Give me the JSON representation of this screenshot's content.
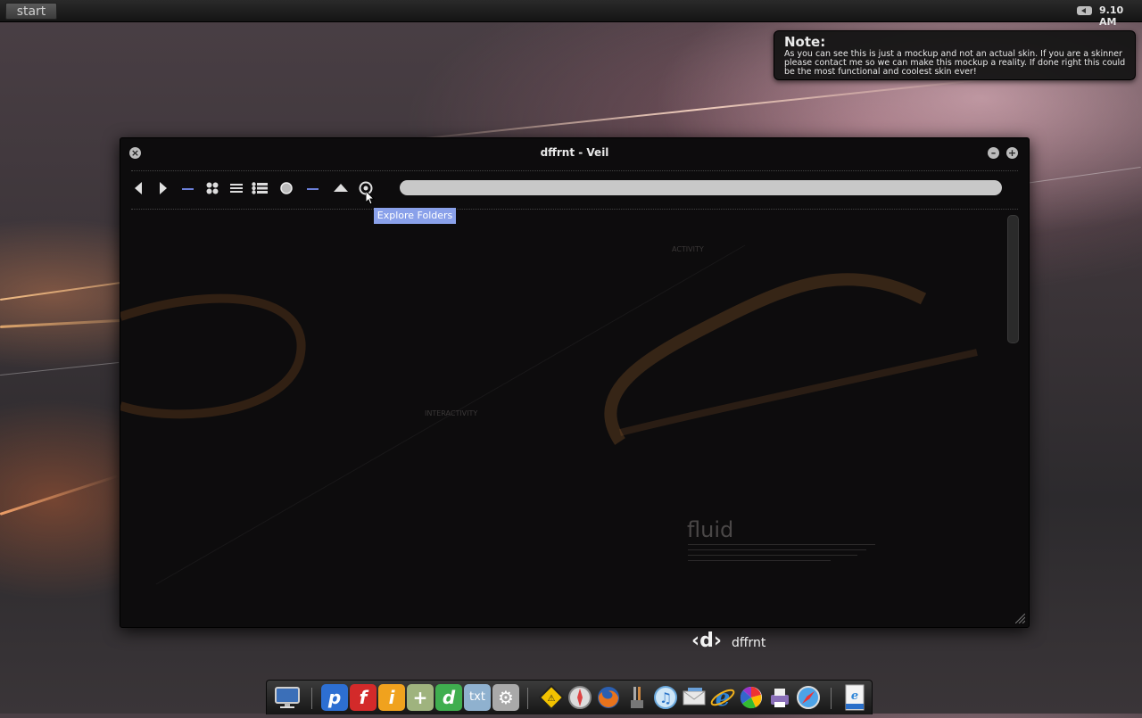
{
  "taskbar": {
    "start_label": "start",
    "clock": "9.10 AM"
  },
  "note": {
    "title": "Note:",
    "body": "As you can see this is just a mockup and not an actual skin. If you are a skinner please contact me so we can make this mockup a reality. If done right this could be the most functional and coolest skin ever!"
  },
  "window": {
    "title": "dffrnt - Veil",
    "tooltip": "Explore Folders",
    "address": "",
    "content": {
      "fluid_label": "fluid",
      "interactivity_label": "INTERACTIVITY",
      "activity_label": "ACTIVITY"
    }
  },
  "brand": {
    "logo": "‹d›",
    "name": "dffrnt"
  },
  "dock": {
    "items": [
      {
        "name": "monitor-icon"
      },
      {
        "name": "p-app-icon",
        "glyph": "p",
        "color": "#2d6fd2"
      },
      {
        "name": "f-app-icon",
        "glyph": "f",
        "color": "#d32a2a"
      },
      {
        "name": "i-app-icon",
        "glyph": "i",
        "color": "#f0a21e"
      },
      {
        "name": "plus-app-icon",
        "glyph": "+",
        "color": "#9fb37e"
      },
      {
        "name": "d-app-icon",
        "glyph": "d",
        "color": "#3fae4f"
      },
      {
        "name": "txt-app-icon",
        "glyph": "txt",
        "color": "#8fb1cf"
      },
      {
        "name": "settings-app-icon",
        "glyph": "⚙",
        "color": "#a9a9a9"
      },
      {
        "name": "warning-sign-icon"
      },
      {
        "name": "compass-app-icon"
      },
      {
        "name": "firefox-icon"
      },
      {
        "name": "brushes-icon"
      },
      {
        "name": "itunes-icon"
      },
      {
        "name": "mail-icon"
      },
      {
        "name": "internet-explorer-icon"
      },
      {
        "name": "picasa-icon"
      },
      {
        "name": "printer-icon"
      },
      {
        "name": "safari-icon"
      },
      {
        "name": "html-file-icon"
      }
    ]
  }
}
